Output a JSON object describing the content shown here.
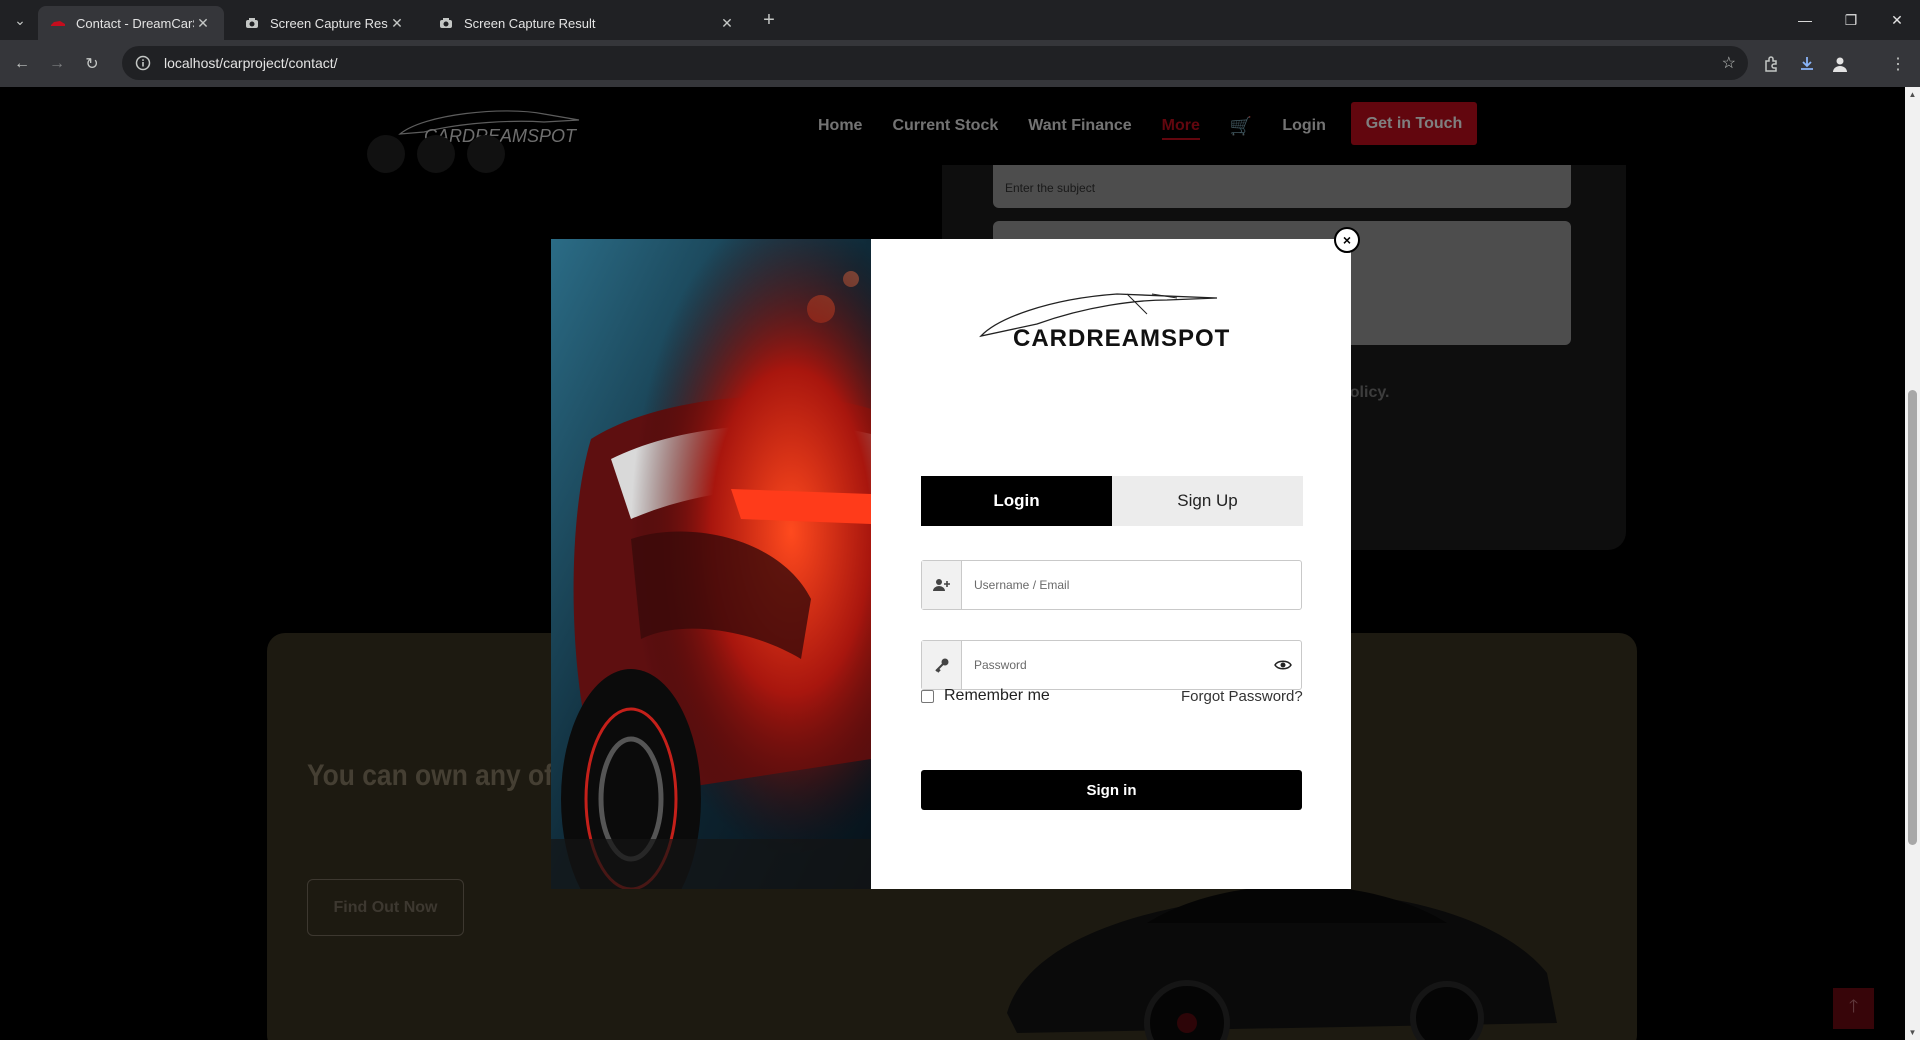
{
  "browser": {
    "tabs": [
      {
        "title": "Contact - DreamCarSpot",
        "active": true
      },
      {
        "title": "Screen Capture Result",
        "active": false
      },
      {
        "title": "Screen Capture Result",
        "active": false
      }
    ],
    "url": "localhost/carproject/contact/"
  },
  "header": {
    "logo_text": "CARDREAMSPOT",
    "nav": [
      "Home",
      "Current Stock",
      "Want Finance",
      "More",
      "Login"
    ],
    "cta": "Get in Touch"
  },
  "contact_form": {
    "subject_placeholder": "Enter the subject",
    "policy_fragment": "policy."
  },
  "promo": {
    "headline": "You can own any of  payments without a",
    "button": "Find Out Now"
  },
  "modal": {
    "logo_text": "CARDREAMSPOT",
    "tabs": {
      "login": "Login",
      "signup": "Sign Up"
    },
    "username_placeholder": "Username / Email",
    "password_placeholder": "Password",
    "remember": "Remember me",
    "forgot": "Forgot Password?",
    "signin": "Sign in",
    "close": "×"
  },
  "colors": {
    "brand_red": "#c40d1d",
    "dark": "#000000"
  }
}
